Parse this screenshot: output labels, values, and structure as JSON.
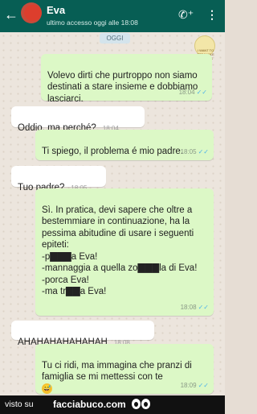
{
  "header": {
    "back_icon": "arrow-left-icon",
    "name": "Eva",
    "status": "ultimo accesso oggi alle 18:08",
    "call_icon": "phone-add-icon",
    "menu_icon": "more-vert-icon",
    "color": "#075e54"
  },
  "chat": {
    "date_chip": "OGGI",
    "sticker_text": "I WANT TO STRANGLE FRIENDS",
    "messages": [
      {
        "dir": "out",
        "text": "Volevo dirti che purtroppo non siamo destinati a stare insieme e dobbiamo lasciarci.",
        "time": "18:04",
        "ticks": "✓✓"
      },
      {
        "dir": "in",
        "text": "Oddio, ma perché?",
        "time": "18:04"
      },
      {
        "dir": "out",
        "text": "Ti spiego, il problema é mio padre.",
        "time": "18:05",
        "ticks": "✓✓"
      },
      {
        "dir": "in",
        "text": "Tuo padre?",
        "time": "18:05"
      },
      {
        "dir": "out",
        "text": "Sì. In pratica, devi sapere che oltre a bestemmiare in continuazione, ha la pessima abitudine di usare i seguenti epiteti:\n-p▇▇▇a Eva!\n-mannaggia a quella zo▇▇▇la di Eva!\n-porca Eva!\n-ma tr▇▇a Eva!",
        "time": "18:08",
        "ticks": "✓✓"
      },
      {
        "dir": "in",
        "text": "AHAHAHAHAHAHAH",
        "time": "18:08"
      },
      {
        "dir": "out",
        "text": "Tu ci ridi, ma immagina che pranzi di famiglia se mi mettessi con te",
        "emoji": "😅",
        "time": "18:09",
        "ticks": "✓✓"
      }
    ],
    "bubble_out_color": "#dcf8c6",
    "bubble_in_color": "#ffffff",
    "tick_color": "#4fb3e8"
  },
  "footer": {
    "visto_su": "visto su",
    "brand": "facciabuco.com"
  }
}
